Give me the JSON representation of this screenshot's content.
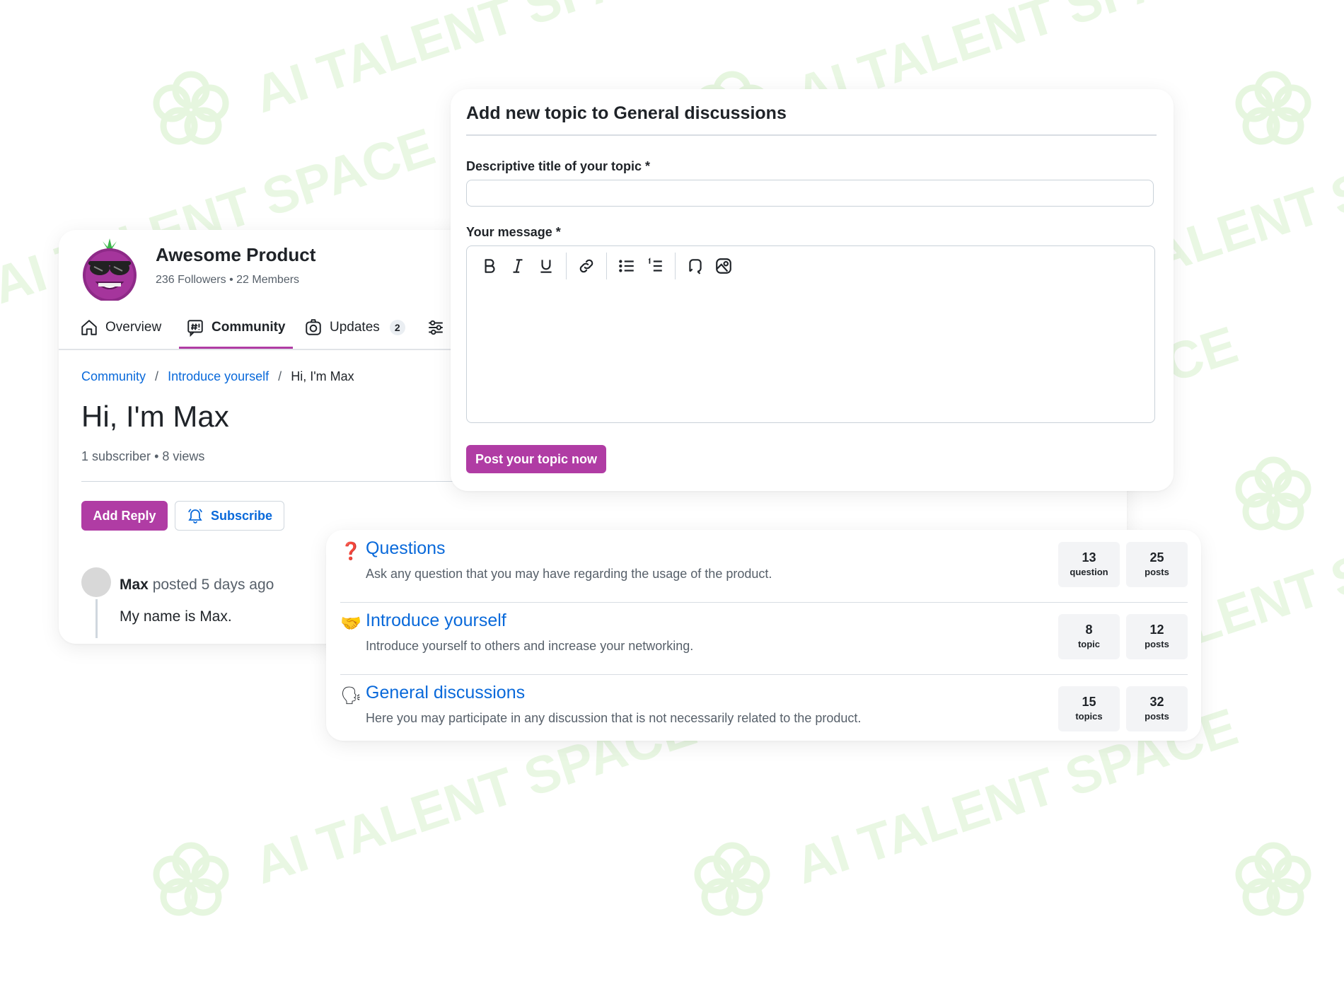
{
  "watermark": {
    "text": "AI TALENT SPACE"
  },
  "product": {
    "name": "Awesome Product",
    "followers": "236 Followers",
    "separator": "•",
    "members": "22 Members"
  },
  "tabs": [
    {
      "label": "Overview",
      "icon": "home-icon"
    },
    {
      "label": "Community",
      "icon": "hashtag-chat-icon",
      "active": true
    },
    {
      "label": "Updates",
      "icon": "camera-icon",
      "badge": "2"
    },
    {
      "label": "",
      "icon": "sliders-icon"
    }
  ],
  "breadcrumb": {
    "items": [
      "Community",
      "Introduce yourself",
      "Hi, I'm Max"
    ],
    "separator": "/"
  },
  "topic": {
    "title": "Hi, I'm Max",
    "subscribers": "1 subscriber",
    "separator": "•",
    "views": "8 views",
    "add_reply_label": "Add Reply",
    "subscribe_label": "Subscribe"
  },
  "reply": {
    "author": "Max",
    "posted": "posted 5 days ago",
    "body": "My name is Max."
  },
  "form": {
    "heading": "Add new topic to General discussions",
    "title_label": "Descriptive title of your topic *",
    "title_value": "",
    "message_label": "Your message *",
    "message_value": "",
    "submit_label": "Post your topic now",
    "toolbar": [
      "bold-icon",
      "italic-icon",
      "underline-icon",
      "link-icon",
      "bullet-list-icon",
      "numbered-list-icon",
      "quote-icon",
      "image-icon"
    ]
  },
  "categories": [
    {
      "icon": "❓",
      "icon_name": "question-mark-icon",
      "title": "Questions",
      "description": "Ask any question that you may have regarding the usage of the product.",
      "count": "13",
      "count_unit": "question",
      "posts": "25",
      "posts_unit": "posts"
    },
    {
      "icon": "🤝",
      "icon_name": "handshake-icon",
      "title": "Introduce yourself",
      "description": "Introduce yourself to others and increase your networking.",
      "count": "8",
      "count_unit": "topic",
      "posts": "12",
      "posts_unit": "posts"
    },
    {
      "icon": "🗣",
      "icon_name": "speaking-head-icon",
      "title": "General discussions",
      "description": "Here you may participate in any discussion that is not necessarily related to the product.",
      "count": "15",
      "count_unit": "topics",
      "posts": "32",
      "posts_unit": "posts"
    }
  ],
  "colors": {
    "accent": "#b03ca4",
    "link": "#0969da",
    "watermark": "#e9f7e3"
  }
}
